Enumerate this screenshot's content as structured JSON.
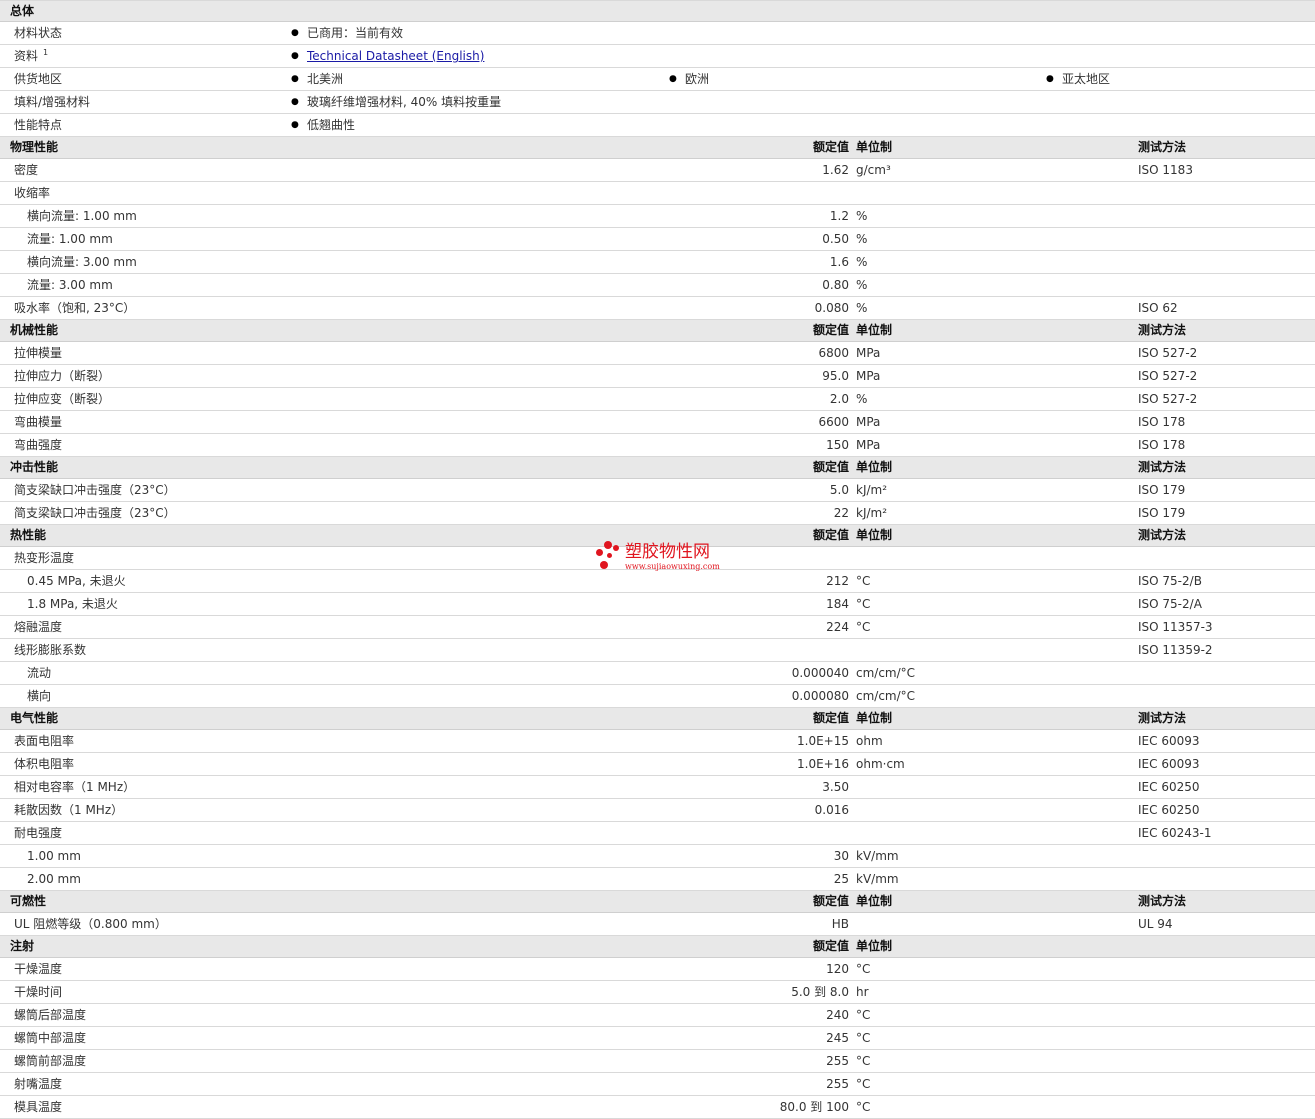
{
  "general": {
    "title": "总体",
    "rows": [
      {
        "label": "材料状态",
        "items": [
          "已商用：当前有效"
        ]
      },
      {
        "label": "资料",
        "sup": "1",
        "items": [
          "Technical Datasheet (English)"
        ],
        "link": true
      },
      {
        "label": "供货地区",
        "items": [
          "北美洲",
          "欧洲",
          "亚太地区"
        ]
      },
      {
        "label": "填料/增强材料",
        "items": [
          "玻璃纤维增强材料, 40% 填料按重量"
        ]
      },
      {
        "label": "性能特点",
        "items": [
          "低翘曲性"
        ]
      }
    ]
  },
  "col_headers": {
    "value": "额定值",
    "unit": "单位制",
    "method": "测试方法"
  },
  "sections": [
    {
      "title": "物理性能",
      "show_method": true,
      "rows": [
        {
          "label": "密度",
          "value": "1.62",
          "unit": "g/cm³",
          "method": "ISO 1183"
        },
        {
          "label": "收缩率",
          "value": "",
          "unit": "",
          "method": ""
        },
        {
          "label": "横向流量: 1.00 mm",
          "sub": true,
          "value": "1.2",
          "unit": "%",
          "method": ""
        },
        {
          "label": "流量: 1.00 mm",
          "sub": true,
          "value": "0.50",
          "unit": "%",
          "method": ""
        },
        {
          "label": "横向流量: 3.00 mm",
          "sub": true,
          "value": "1.6",
          "unit": "%",
          "method": ""
        },
        {
          "label": "流量: 3.00 mm",
          "sub": true,
          "value": "0.80",
          "unit": "%",
          "method": ""
        },
        {
          "label": "吸水率（饱和, 23°C）",
          "value": "0.080",
          "unit": "%",
          "method": "ISO 62"
        }
      ]
    },
    {
      "title": "机械性能",
      "show_method": true,
      "rows": [
        {
          "label": "拉伸模量",
          "value": "6800",
          "unit": "MPa",
          "method": "ISO 527-2"
        },
        {
          "label": "拉伸应力（断裂）",
          "value": "95.0",
          "unit": "MPa",
          "method": "ISO 527-2"
        },
        {
          "label": "拉伸应变（断裂）",
          "value": "2.0",
          "unit": "%",
          "method": "ISO 527-2"
        },
        {
          "label": "弯曲模量",
          "value": "6600",
          "unit": "MPa",
          "method": "ISO 178"
        },
        {
          "label": "弯曲强度",
          "value": "150",
          "unit": "MPa",
          "method": "ISO 178"
        }
      ]
    },
    {
      "title": "冲击性能",
      "show_method": true,
      "rows": [
        {
          "label": "简支梁缺口冲击强度（23°C）",
          "value": "5.0",
          "unit": "kJ/m²",
          "method": "ISO 179"
        },
        {
          "label": "简支梁缺口冲击强度（23°C）",
          "value": "22",
          "unit": "kJ/m²",
          "method": "ISO 179"
        }
      ]
    },
    {
      "title": "热性能",
      "show_method": true,
      "rows": [
        {
          "label": "热变形温度",
          "value": "",
          "unit": "",
          "method": ""
        },
        {
          "label": "0.45 MPa, 未退火",
          "sub": true,
          "value": "212",
          "unit": "°C",
          "method": "ISO 75-2/B"
        },
        {
          "label": "1.8 MPa, 未退火",
          "sub": true,
          "value": "184",
          "unit": "°C",
          "method": "ISO 75-2/A"
        },
        {
          "label": "熔融温度",
          "value": "224",
          "unit": "°C",
          "method": "ISO 11357-3"
        },
        {
          "label": "线形膨胀系数",
          "value": "",
          "unit": "",
          "method": "ISO 11359-2"
        },
        {
          "label": "流动",
          "sub": true,
          "value": "0.000040",
          "unit": "cm/cm/°C",
          "method": ""
        },
        {
          "label": "横向",
          "sub": true,
          "value": "0.000080",
          "unit": "cm/cm/°C",
          "method": ""
        }
      ]
    },
    {
      "title": "电气性能",
      "show_method": true,
      "rows": [
        {
          "label": "表面电阻率",
          "value": "1.0E+15",
          "unit": "ohm",
          "method": "IEC 60093"
        },
        {
          "label": "体积电阻率",
          "value": "1.0E+16",
          "unit": "ohm·cm",
          "method": "IEC 60093"
        },
        {
          "label": "相对电容率（1 MHz）",
          "value": "3.50",
          "unit": "",
          "method": "IEC 60250"
        },
        {
          "label": "耗散因数（1 MHz）",
          "value": "0.016",
          "unit": "",
          "method": "IEC 60250"
        },
        {
          "label": "耐电强度",
          "value": "",
          "unit": "",
          "method": "IEC 60243-1"
        },
        {
          "label": "1.00 mm",
          "sub": true,
          "value": "30",
          "unit": "kV/mm",
          "method": ""
        },
        {
          "label": "2.00 mm",
          "sub": true,
          "value": "25",
          "unit": "kV/mm",
          "method": ""
        }
      ]
    },
    {
      "title": "可燃性",
      "show_method": true,
      "rows": [
        {
          "label": "UL 阻燃等级（0.800 mm）",
          "value": "HB",
          "unit": "",
          "method": "UL 94"
        }
      ]
    },
    {
      "title": "注射",
      "show_method": false,
      "rows": [
        {
          "label": "干燥温度",
          "value": "120",
          "unit": "°C",
          "method": ""
        },
        {
          "label": "干燥时间",
          "value": "5.0 到  8.0",
          "unit": "hr",
          "method": ""
        },
        {
          "label": "螺筒后部温度",
          "value": "240",
          "unit": "°C",
          "method": ""
        },
        {
          "label": "螺筒中部温度",
          "value": "245",
          "unit": "°C",
          "method": ""
        },
        {
          "label": "螺筒前部温度",
          "value": "255",
          "unit": "°C",
          "method": ""
        },
        {
          "label": "射嘴温度",
          "value": "255",
          "unit": "°C",
          "method": ""
        },
        {
          "label": "模具温度",
          "value": "80.0 到  100",
          "unit": "°C",
          "method": ""
        }
      ]
    }
  ],
  "watermark": {
    "text": "塑胶物性网",
    "url": "www.sujiaowuxing.com",
    "color": "#e0151f"
  }
}
